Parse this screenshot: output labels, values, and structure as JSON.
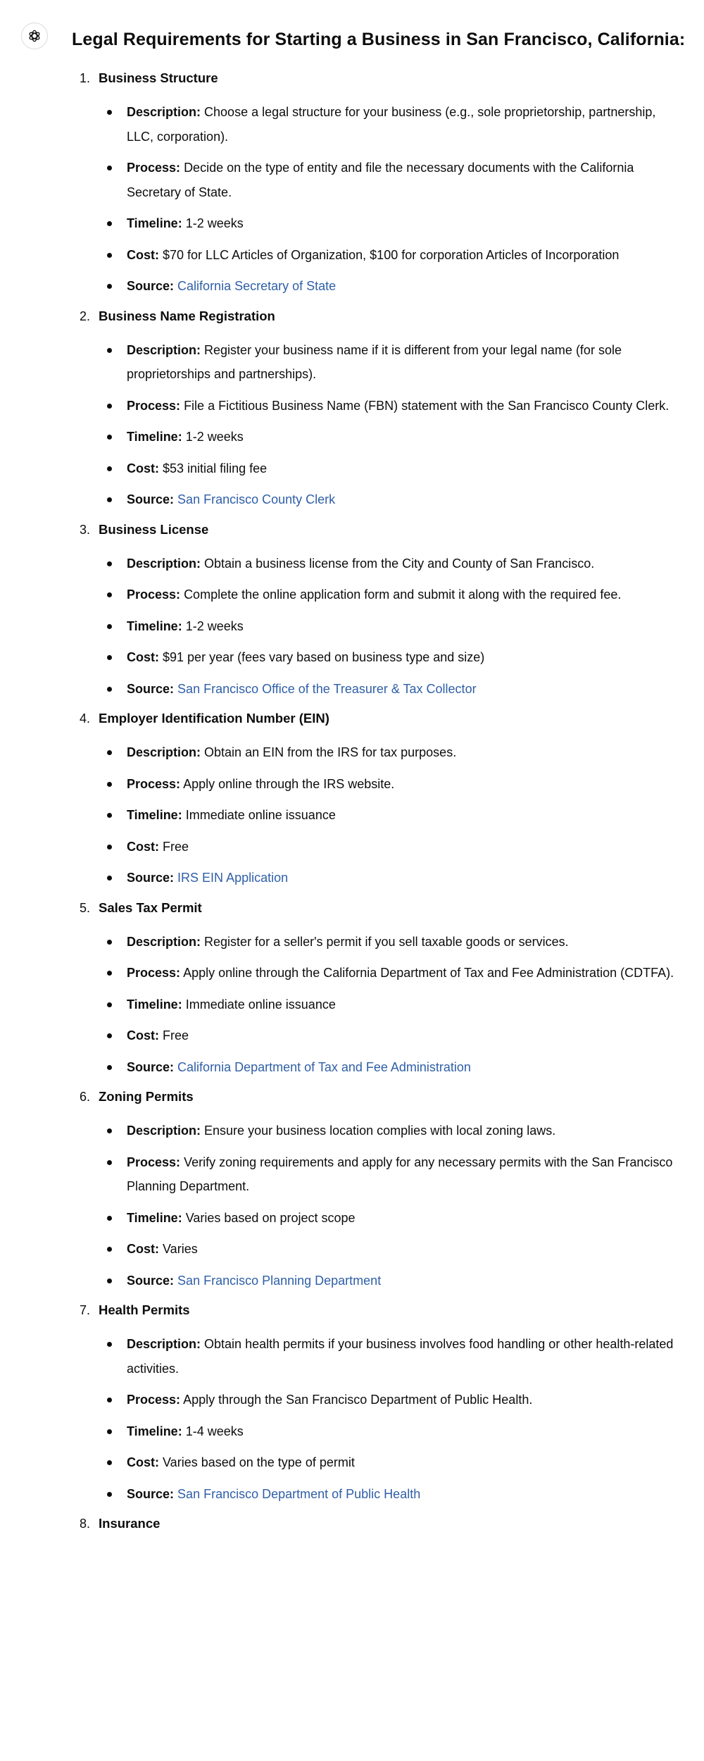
{
  "chat": {
    "assistant_icon": "openai-logo-icon",
    "title": "Legal Requirements for Starting a Business in San Francisco, California:",
    "sections": [
      {
        "number": "1.",
        "title": "Business Structure",
        "items": [
          {
            "label": "Description:",
            "text": "Choose a legal structure for your business (e.g., sole proprietorship, partnership, LLC, corporation).",
            "link": false
          },
          {
            "label": "Process:",
            "text": "Decide on the type of entity and file the necessary documents with the California Secretary of State.",
            "link": false
          },
          {
            "label": "Timeline:",
            "text": "1-2 weeks",
            "link": false
          },
          {
            "label": "Cost:",
            "text": "$70 for LLC Articles of Organization, $100 for corporation Articles of Incorporation",
            "link": false
          },
          {
            "label": "Source:",
            "text": "California Secretary of State",
            "link": true
          }
        ]
      },
      {
        "number": "2.",
        "title": "Business Name Registration",
        "items": [
          {
            "label": "Description:",
            "text": "Register your business name if it is different from your legal name (for sole proprietorships and partnerships).",
            "link": false
          },
          {
            "label": "Process:",
            "text": "File a Fictitious Business Name (FBN) statement with the San Francisco County Clerk.",
            "link": false
          },
          {
            "label": "Timeline:",
            "text": "1-2 weeks",
            "link": false
          },
          {
            "label": "Cost:",
            "text": "$53 initial filing fee",
            "link": false
          },
          {
            "label": "Source:",
            "text": "San Francisco County Clerk",
            "link": true
          }
        ]
      },
      {
        "number": "3.",
        "title": "Business License",
        "items": [
          {
            "label": "Description:",
            "text": "Obtain a business license from the City and County of San Francisco.",
            "link": false
          },
          {
            "label": "Process:",
            "text": "Complete the online application form and submit it along with the required fee.",
            "link": false
          },
          {
            "label": "Timeline:",
            "text": "1-2 weeks",
            "link": false
          },
          {
            "label": "Cost:",
            "text": "$91 per year (fees vary based on business type and size)",
            "link": false
          },
          {
            "label": "Source:",
            "text": "San Francisco Office of the Treasurer & Tax Collector",
            "link": true
          }
        ]
      },
      {
        "number": "4.",
        "title": "Employer Identification Number (EIN)",
        "items": [
          {
            "label": "Description:",
            "text": "Obtain an EIN from the IRS for tax purposes.",
            "link": false
          },
          {
            "label": "Process:",
            "text": "Apply online through the IRS website.",
            "link": false
          },
          {
            "label": "Timeline:",
            "text": "Immediate online issuance",
            "link": false
          },
          {
            "label": "Cost:",
            "text": "Free",
            "link": false
          },
          {
            "label": "Source:",
            "text": "IRS EIN Application",
            "link": true
          }
        ]
      },
      {
        "number": "5.",
        "title": "Sales Tax Permit",
        "items": [
          {
            "label": "Description:",
            "text": "Register for a seller's permit if you sell taxable goods or services.",
            "link": false
          },
          {
            "label": "Process:",
            "text": "Apply online through the California Department of Tax and Fee Administration (CDTFA).",
            "link": false
          },
          {
            "label": "Timeline:",
            "text": "Immediate online issuance",
            "link": false
          },
          {
            "label": "Cost:",
            "text": "Free",
            "link": false
          },
          {
            "label": "Source:",
            "text": "California Department of Tax and Fee Administration",
            "link": true
          }
        ]
      },
      {
        "number": "6.",
        "title": "Zoning Permits",
        "items": [
          {
            "label": "Description:",
            "text": "Ensure your business location complies with local zoning laws.",
            "link": false
          },
          {
            "label": "Process:",
            "text": "Verify zoning requirements and apply for any necessary permits with the San Francisco Planning Department.",
            "link": false
          },
          {
            "label": "Timeline:",
            "text": "Varies based on project scope",
            "link": false
          },
          {
            "label": "Cost:",
            "text": "Varies",
            "link": false
          },
          {
            "label": "Source:",
            "text": "San Francisco Planning Department",
            "link": true
          }
        ]
      },
      {
        "number": "7.",
        "title": "Health Permits",
        "items": [
          {
            "label": "Description:",
            "text": "Obtain health permits if your business involves food handling or other health-related activities.",
            "link": false
          },
          {
            "label": "Process:",
            "text": "Apply through the San Francisco Department of Public Health.",
            "link": false
          },
          {
            "label": "Timeline:",
            "text": "1-4 weeks",
            "link": false
          },
          {
            "label": "Cost:",
            "text": "Varies based on the type of permit",
            "link": false
          },
          {
            "label": "Source:",
            "text": "San Francisco Department of Public Health",
            "link": true
          }
        ]
      },
      {
        "number": "8.",
        "title": "Insurance",
        "items": []
      }
    ]
  }
}
